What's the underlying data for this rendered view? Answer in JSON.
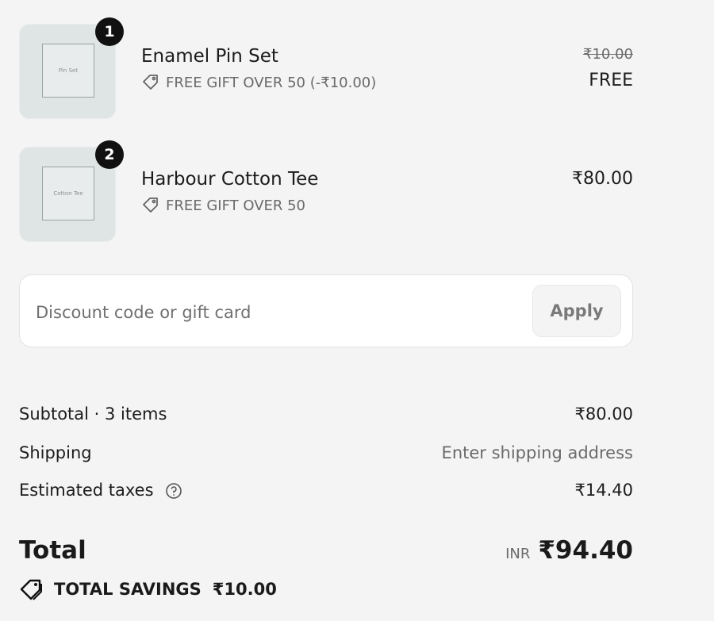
{
  "items": [
    {
      "quantity": "1",
      "thumb_label": "Pin Set",
      "name": "Enamel Pin Set",
      "discount": "FREE GIFT OVER 50 (-₹10.00)",
      "original_price": "₹10.00",
      "price": "FREE"
    },
    {
      "quantity": "2",
      "thumb_label": "Cotton Tee",
      "name": "Harbour Cotton Tee",
      "discount": "FREE GIFT OVER 50",
      "price": "₹80.00"
    }
  ],
  "discount": {
    "placeholder": "Discount code or gift card",
    "apply_label": "Apply"
  },
  "summary": {
    "subtotal_label": "Subtotal · 3 items",
    "subtotal_value": "₹80.00",
    "shipping_label": "Shipping",
    "shipping_value": "Enter shipping address",
    "taxes_label": "Estimated taxes",
    "taxes_value": "₹14.40",
    "total_label": "Total",
    "currency": "INR",
    "total_value": "₹94.40",
    "savings_label": "TOTAL SAVINGS",
    "savings_value": "₹10.00"
  },
  "icons": {
    "tag": "tag-icon",
    "help": "help-circle-icon"
  }
}
